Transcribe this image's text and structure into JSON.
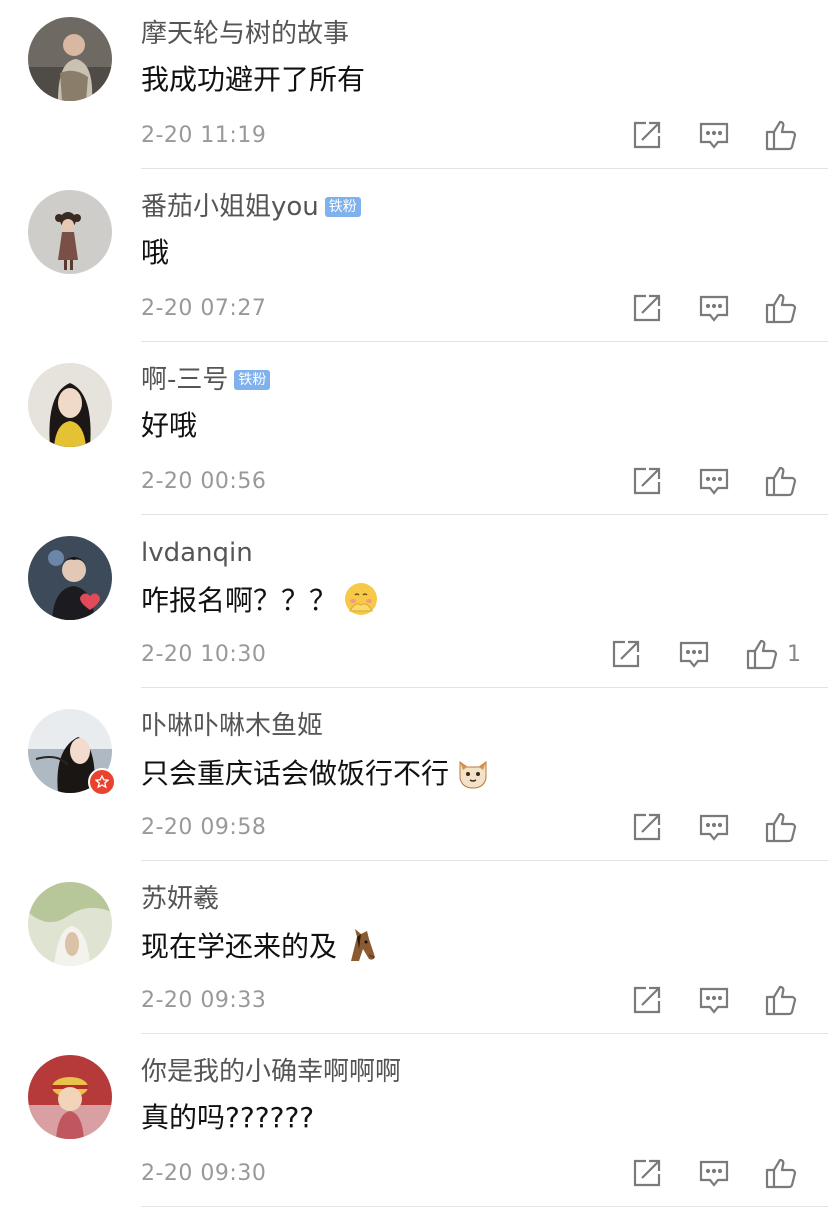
{
  "comments": [
    {
      "user": "摩天轮与树的故事",
      "text": "我成功避开了所有",
      "time": "2-20 11:19"
    },
    {
      "user": "番茄小姐姐you",
      "badge": "铁粉",
      "text": "哦",
      "time": "2-20 07:27"
    },
    {
      "user": "啊-三号",
      "badge": "铁粉",
      "text": "好哦",
      "time": "2-20 00:56"
    },
    {
      "user": "lvdanqin",
      "text": "咋报名啊？？？",
      "emoji": "shy-hands-emoji",
      "time": "2-20 10:30",
      "likes": "1"
    },
    {
      "user": "卟啉卟啉木鱼姬",
      "text": "只会重庆话会做饭行不行",
      "emoji": "cat-face-emoji",
      "verified": true,
      "time": "2-20 09:58"
    },
    {
      "user": "苏妍羲",
      "text": "现在学还来的及",
      "emoji": "horse-face-emoji",
      "time": "2-20 09:33"
    },
    {
      "user": "你是我的小确幸啊啊啊",
      "text": "真的吗??????",
      "time": "2-20 09:30"
    }
  ],
  "icons": {
    "share": "share-icon",
    "reply": "reply-icon",
    "like": "thumbs-up-icon"
  },
  "colors": {
    "badge": "#7fb1ec",
    "verified": "#e8432e",
    "meta": "#999999"
  }
}
